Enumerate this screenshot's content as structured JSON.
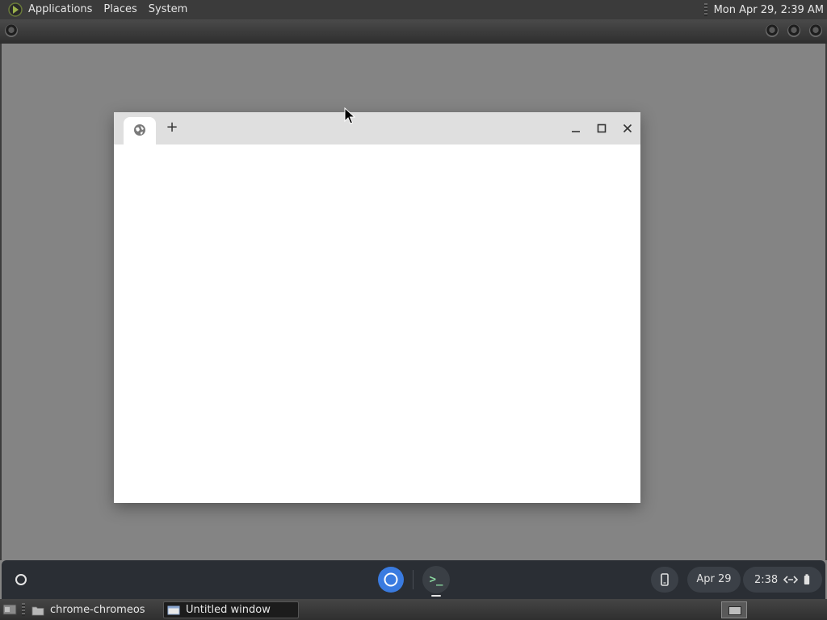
{
  "top_panel": {
    "menu": [
      "Applications",
      "Places",
      "System"
    ],
    "clock": "Mon Apr 29,  2:39 AM"
  },
  "browser_window": {
    "tab_icon": "globe-icon",
    "new_tab_label": "+",
    "controls": [
      "minimize-icon",
      "maximize-icon",
      "close-icon"
    ]
  },
  "shelf": {
    "launcher_icon": "launcher-circle-icon",
    "apps": [
      "chrome-icon",
      "terminal-icon"
    ],
    "terminal_glyph": ">_",
    "phone_hub_icon": "phone-icon",
    "date": "Apr 29",
    "tray_time": "2:38",
    "tray_icons": [
      "network-icon",
      "battery-icon"
    ]
  },
  "taskbar": {
    "tasks": [
      {
        "label": "chrome-chromeos",
        "icon": "folder-icon",
        "active": false
      },
      {
        "label": "Untitled window",
        "icon": "window-icon",
        "active": true
      }
    ]
  },
  "colors": {
    "desktop": "#848484",
    "shelf": "#2a2e34",
    "panel": "#3b3b3b",
    "chrome_blue": "#3a7be0"
  }
}
